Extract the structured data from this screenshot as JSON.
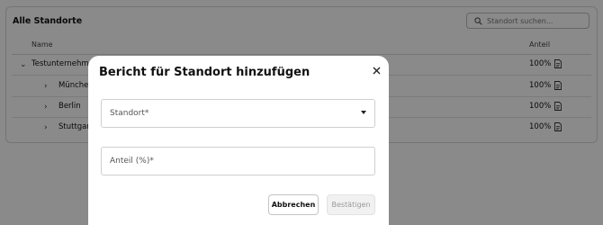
{
  "card": {
    "title": "Alle Standorte",
    "search_placeholder": "Standort suchen...",
    "columns": {
      "name": "Name",
      "share": "Anteil"
    },
    "rows": [
      {
        "name": "Testunternehmen",
        "share": "100%",
        "expanded": true,
        "level": 0
      },
      {
        "name": "München",
        "share": "100%",
        "expanded": false,
        "level": 1
      },
      {
        "name": "Berlin",
        "share": "100%",
        "expanded": false,
        "level": 1
      },
      {
        "name": "Stuttgart",
        "share": "100%",
        "expanded": false,
        "level": 1
      }
    ]
  },
  "dialog": {
    "title": "Bericht für Standort hinzufügen",
    "location_field": {
      "label": "Standort*",
      "value": ""
    },
    "share_field": {
      "label": "Anteil (%)*",
      "value": ""
    },
    "cancel_label": "Abbrechen",
    "confirm_label": "Bestätigen",
    "confirm_disabled": true
  },
  "colors": {
    "overlay": "rgba(0,0,0,0.46)",
    "dialog_bg": "#ffffff",
    "border": "#d6d6d6"
  }
}
